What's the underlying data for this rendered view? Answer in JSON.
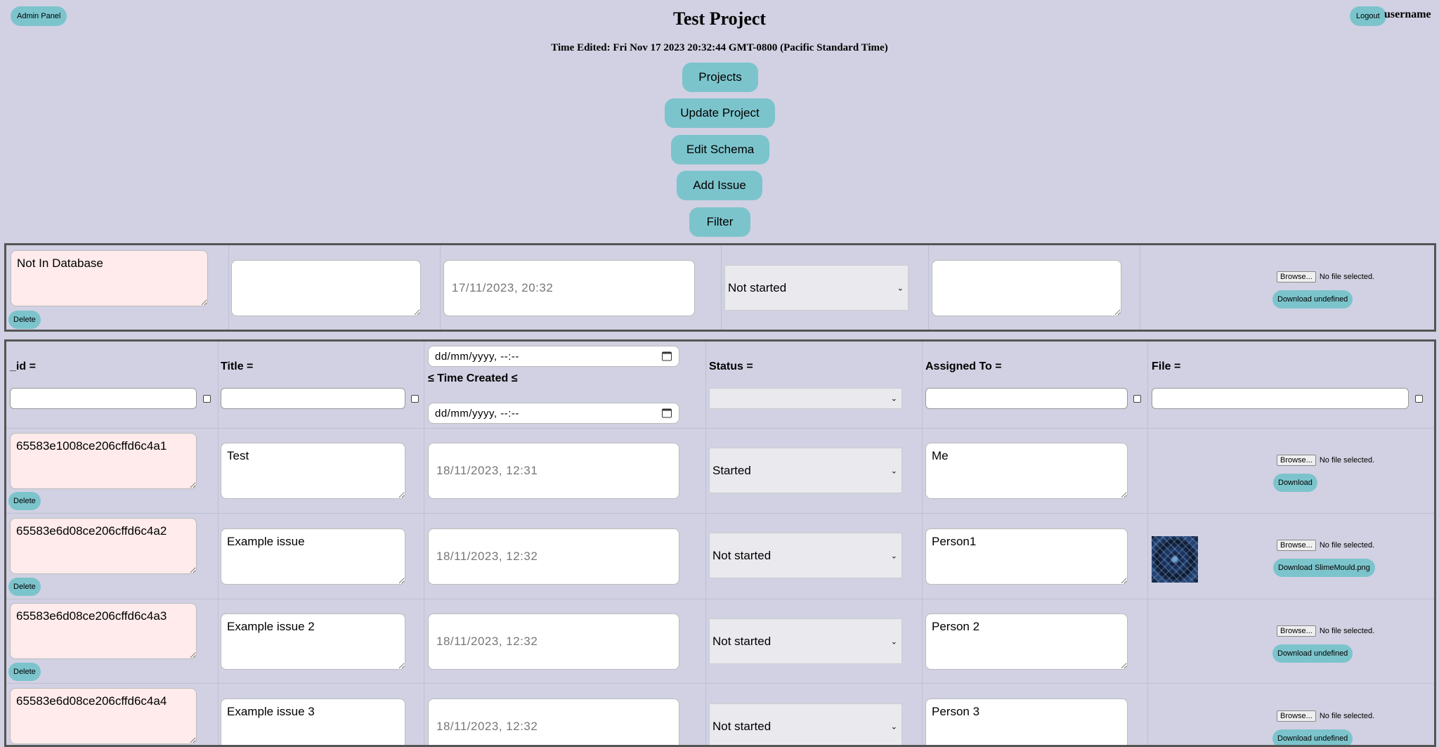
{
  "header": {
    "admin_label": "Admin Panel",
    "logout_label": "Logout",
    "username": "username",
    "title": "Test Project",
    "time_edited": "Time Edited: Fri Nov 17 2023 20:32:44 GMT-0800 (Pacific Standard Time)"
  },
  "nav": [
    "Projects",
    "Update Project",
    "Edit Schema",
    "Add Issue",
    "Filter"
  ],
  "new_row": {
    "id_value": "Not In Database",
    "delete_label": "Delete",
    "title_value": "",
    "time_value": "17/11/2023, 20:32",
    "status_value": "Not started",
    "assigned_value": "",
    "browse_label": "Browse...",
    "no_file_label": "No file selected.",
    "download_label": "Download undefined"
  },
  "table": {
    "columns": [
      "_id =",
      "Title =",
      "≤ Time Created ≤",
      "Status =",
      "Assigned To =",
      "File ="
    ],
    "date_placeholder": "dd/mm/yyyy, --:--",
    "browse_label": "Browse...",
    "no_file_label": "No file selected.",
    "delete_label": "Delete",
    "rows": [
      {
        "id": "65583e1008ce206cffd6c4a1",
        "title": "Test",
        "time": "18/11/2023, 12:31",
        "status": "Started",
        "assigned": "Me",
        "download": "Download",
        "has_thumb": false
      },
      {
        "id": "65583e6d08ce206cffd6c4a2",
        "title": "Example issue",
        "time": "18/11/2023, 12:32",
        "status": "Not started",
        "assigned": "Person1",
        "download": "Download SlimeMould.png",
        "has_thumb": true
      },
      {
        "id": "65583e6d08ce206cffd6c4a3",
        "title": "Example issue 2",
        "time": "18/11/2023, 12:32",
        "status": "Not started",
        "assigned": "Person 2",
        "download": "Download undefined",
        "has_thumb": false
      },
      {
        "id": "65583e6d08ce206cffd6c4a4",
        "title": "Example issue 3",
        "time": "18/11/2023, 12:32",
        "status": "Not started",
        "assigned": "Person 3",
        "download": "Download undefined",
        "has_thumb": false
      }
    ]
  },
  "colors": {
    "background": "#d1d1e3",
    "button": "#7cc4cc",
    "id_field": "#ffebeb",
    "select": "#e9e9ee"
  }
}
